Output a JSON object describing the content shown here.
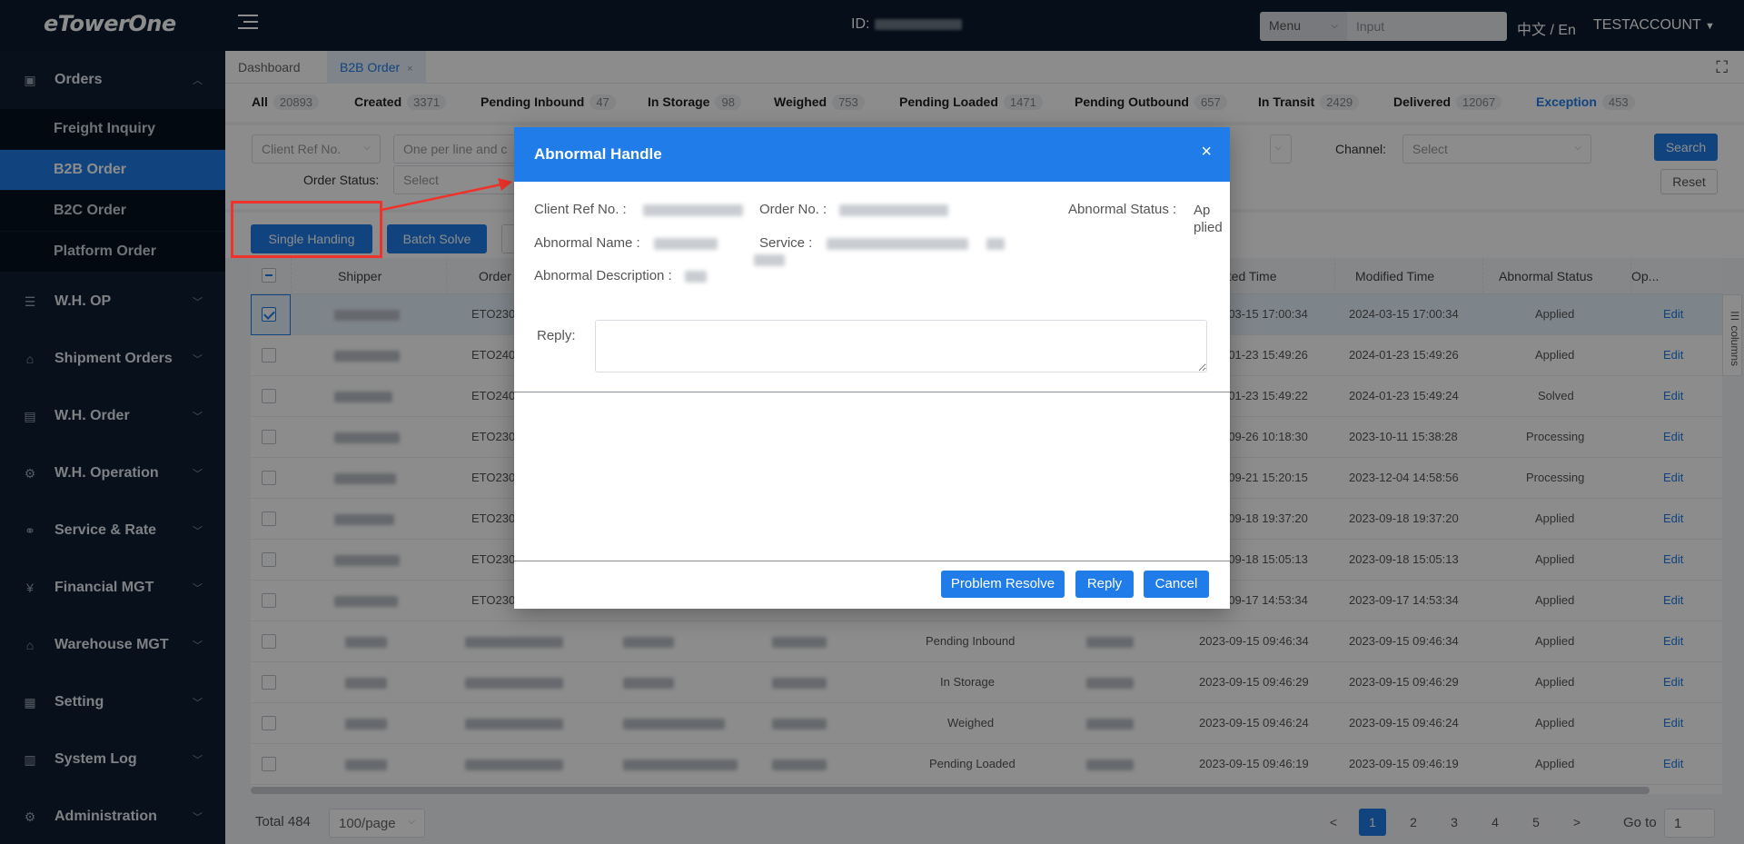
{
  "header": {
    "logo": "eTowerOne",
    "id_label": "ID:",
    "menu_select": "Menu",
    "input_placeholder": "Input",
    "language": "中文 / En",
    "account": "TESTACCOUNT"
  },
  "sidebar": {
    "orders": "Orders",
    "sub_items": [
      {
        "label": "Freight Inquiry"
      },
      {
        "label": "B2B Order"
      },
      {
        "label": "B2C Order"
      },
      {
        "label": "Platform Order"
      }
    ],
    "groups": [
      {
        "label": "W.H. OP",
        "icon": "warehouse-op-icon"
      },
      {
        "label": "Shipment Orders",
        "icon": "shipment-icon"
      },
      {
        "label": "W.H. Order",
        "icon": "wh-order-icon"
      },
      {
        "label": "W.H. Operation",
        "icon": "wh-operation-icon"
      },
      {
        "label": "Service & Rate",
        "icon": "service-rate-icon"
      },
      {
        "label": "Financial MGT",
        "icon": "financial-icon"
      },
      {
        "label": "Warehouse MGT",
        "icon": "warehouse-mgt-icon"
      },
      {
        "label": "Setting",
        "icon": "setting-icon"
      },
      {
        "label": "System Log",
        "icon": "system-log-icon"
      },
      {
        "label": "Administration",
        "icon": "administration-icon"
      }
    ]
  },
  "tabs": {
    "dashboard": "Dashboard",
    "b2b": "B2B Order",
    "close": "×"
  },
  "status": [
    {
      "label": "All",
      "count": "20893"
    },
    {
      "label": "Created",
      "count": "3371"
    },
    {
      "label": "Pending Inbound",
      "count": "47"
    },
    {
      "label": "In Storage",
      "count": "98"
    },
    {
      "label": "Weighed",
      "count": "753"
    },
    {
      "label": "Pending Loaded",
      "count": "1471"
    },
    {
      "label": "Pending Outbound",
      "count": "657"
    },
    {
      "label": "In Transit",
      "count": "2429"
    },
    {
      "label": "Delivered",
      "count": "12067"
    },
    {
      "label": "Exception",
      "count": "453"
    }
  ],
  "filters": {
    "client_ref_select": "Client Ref No.",
    "one_per_line": "One per line and c",
    "channel_label": "Channel:",
    "channel_placeholder": "Select",
    "order_status_label": "Order Status:",
    "order_status_placeholder": "Select",
    "search": "Search",
    "reset": "Reset"
  },
  "actions": {
    "single_handing": "Single Handing",
    "batch_solve": "Batch Solve"
  },
  "table": {
    "headers": {
      "shipper": "Shipper",
      "order": "Order",
      "created_time": "ated Time",
      "modified_time": "Modified Time",
      "abnormal_status": "Abnormal Status",
      "op": "Op..."
    },
    "columns_tool": "columns",
    "edit": "Edit",
    "rows": [
      {
        "order": "ETO230",
        "created": "-03-15 17:00:34",
        "modified": "2024-03-15 17:00:34",
        "status": "Applied",
        "selected": true
      },
      {
        "order": "ETO240",
        "created": "-01-23 15:49:26",
        "modified": "2024-01-23 15:49:26",
        "status": "Applied"
      },
      {
        "order": "ETO240",
        "created": "-01-23 15:49:22",
        "modified": "2024-01-23 15:49:24",
        "status": "Solved"
      },
      {
        "order": "ETO230",
        "created": "-09-26 10:18:30",
        "modified": "2023-10-11 15:38:28",
        "status": "Processing"
      },
      {
        "order": "ETO230",
        "created": "-09-21 15:20:15",
        "modified": "2023-12-04 14:58:56",
        "status": "Processing"
      },
      {
        "order": "ETO230",
        "created": "-09-18 19:37:20",
        "modified": "2023-09-18 19:37:20",
        "status": "Applied"
      },
      {
        "order": "ETO230",
        "created": "-09-18 15:05:13",
        "modified": "2023-09-18 15:05:13",
        "status": "Applied"
      },
      {
        "order": "ETO230",
        "created": "-09-17 14:53:34",
        "modified": "2023-09-17 14:53:34",
        "status": "Applied"
      },
      {
        "order": "",
        "type": "Pending Inbound",
        "created": "2023-09-15 09:46:34",
        "modified": "2023-09-15 09:46:34",
        "status": "Applied"
      },
      {
        "order": "",
        "type": "In Storage",
        "created": "2023-09-15 09:46:29",
        "modified": "2023-09-15 09:46:29",
        "status": "Applied"
      },
      {
        "order": "",
        "type": "Weighed",
        "created": "2023-09-15 09:46:24",
        "modified": "2023-09-15 09:46:24",
        "status": "Applied"
      },
      {
        "order": "",
        "type": "Pending Loaded",
        "created": "2023-09-15 09:46:19",
        "modified": "2023-09-15 09:46:19",
        "status": "Applied"
      }
    ]
  },
  "pagination": {
    "total": "Total 484",
    "per_page": "100/page",
    "pages": [
      "1",
      "2",
      "3",
      "4",
      "5"
    ],
    "prev": "<",
    "next": ">",
    "goto_label": "Go to",
    "goto_value": "1"
  },
  "modal": {
    "title": "Abnormal Handle",
    "close": "×",
    "client_ref_label": "Client Ref No. :",
    "order_no_label": "Order No. :",
    "abnormal_status_label": "Abnormal Status :",
    "abnormal_status_value": "Ap plied",
    "abnormal_name_label": "Abnormal Name :",
    "service_label": "Service :",
    "abnormal_desc_label": "Abnormal Description :",
    "reply_label": "Reply:",
    "problem_resolve": "Problem Resolve",
    "reply_button": "Reply",
    "cancel": "Cancel"
  },
  "colors": {
    "primary": "#1f7ce8",
    "sidebar": "#0f1e33",
    "annotation_red": "#f0322a"
  }
}
